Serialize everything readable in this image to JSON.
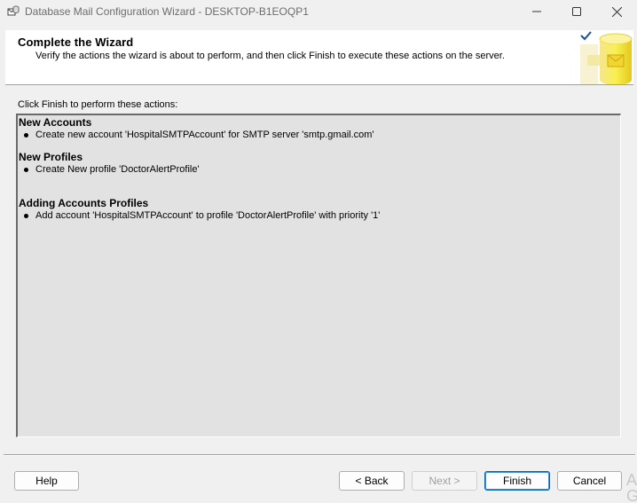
{
  "window": {
    "title": "Database Mail Configuration Wizard - DESKTOP-B1EOQP1",
    "minimize_icon": "minimize-icon",
    "maximize_icon": "maximize-icon",
    "close_icon": "close-icon"
  },
  "header": {
    "title": "Complete the Wizard",
    "description": "Verify the actions the wizard is about to perform, and then click Finish to execute these actions on the server.",
    "graphic_icon": "database-wizard-icon"
  },
  "prompt": "Click Finish to perform these actions:",
  "actions": [
    {
      "heading": "New Accounts",
      "items": [
        "Create new account 'HospitalSMTPAccount' for SMTP server 'smtp.gmail.com'"
      ]
    },
    {
      "heading": "New Profiles",
      "items": [
        "Create New profile 'DoctorAlertProfile'"
      ]
    },
    {
      "heading": "Adding Accounts Profiles",
      "items": [
        "Add account 'HospitalSMTPAccount' to profile 'DoctorAlertProfile' with priority '1'"
      ]
    }
  ],
  "buttons": {
    "help": "Help",
    "back": "< Back",
    "next": "Next >",
    "finish": "Finish",
    "cancel": "Cancel"
  },
  "watermark": "A\nG",
  "colors": {
    "accent": "#0067c0",
    "window_bg": "#f0f0f0",
    "box_bg": "#e2e2e2"
  }
}
